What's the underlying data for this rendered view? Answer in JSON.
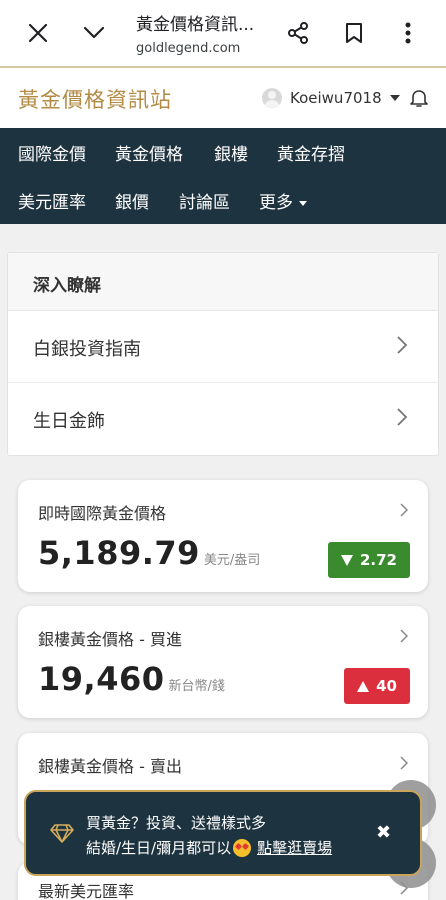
{
  "browser": {
    "title": "黃金價格資訊...",
    "url": "goldlegend.com"
  },
  "header": {
    "logo": "黃金價格資訊站",
    "username": "Koeiwu7018"
  },
  "nav": {
    "row1": [
      "國際金價",
      "黃金價格",
      "銀樓",
      "黃金存摺"
    ],
    "row2": [
      "美元匯率",
      "銀價",
      "討論區",
      "更多"
    ]
  },
  "deep": {
    "heading": "深入瞭解",
    "items": [
      "白銀投資指南",
      "生日金飾"
    ]
  },
  "cards": [
    {
      "title": "即時國際黃金價格",
      "value": "5,189.79",
      "unit": "美元/盎司",
      "change": "2.72",
      "direction": "down"
    },
    {
      "title": "銀樓黃金價格 - 買進",
      "value": "19,460",
      "unit": "新台幣/錢",
      "change": "40",
      "direction": "up"
    },
    {
      "title": "銀樓黃金價格 - 賣出"
    }
  ],
  "peek_card": {
    "title": "最新美元匯率"
  },
  "toast": {
    "line1": "買黃金？投資、送禮樣式多",
    "line2": "結婚/生日/彌月都可以",
    "link": "點擊逛賣場"
  },
  "colors": {
    "nav_bg": "#1e3340",
    "logo_gold": "#b38b45",
    "down_green": "#3a8a2e",
    "up_red": "#dc2f3e",
    "toast_border": "#c9a45a"
  }
}
